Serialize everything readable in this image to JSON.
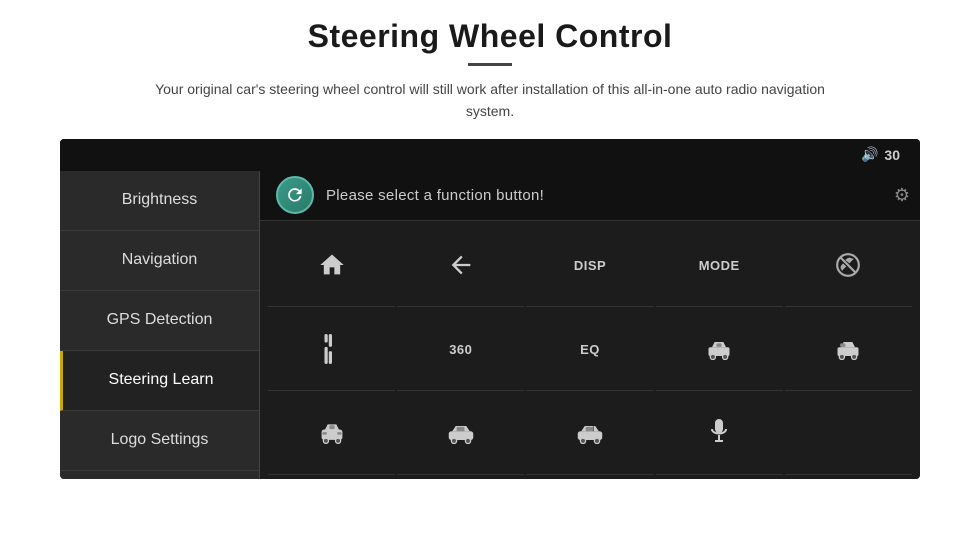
{
  "page": {
    "title": "Steering Wheel Control",
    "subtitle": "Your original car's steering wheel control will still work after installation of this all-in-one auto radio navigation system.",
    "divider": true
  },
  "topbar": {
    "volume_icon": "🔊",
    "volume_value": "30"
  },
  "sidebar": {
    "items": [
      {
        "id": "brightness",
        "label": "Brightness",
        "active": false
      },
      {
        "id": "navigation",
        "label": "Navigation",
        "active": false
      },
      {
        "id": "gps-detection",
        "label": "GPS Detection",
        "active": false
      },
      {
        "id": "steering-learn",
        "label": "Steering Learn",
        "active": true
      },
      {
        "id": "logo-settings",
        "label": "Logo Settings",
        "active": false
      }
    ]
  },
  "function_bar": {
    "prompt": "Please select a function button!"
  },
  "grid": {
    "rows": [
      [
        {
          "type": "home",
          "label": ""
        },
        {
          "type": "back",
          "label": ""
        },
        {
          "type": "text",
          "label": "DISP"
        },
        {
          "type": "text",
          "label": "MODE"
        },
        {
          "type": "no-call",
          "label": ""
        }
      ],
      [
        {
          "type": "tuner",
          "label": ""
        },
        {
          "type": "text",
          "label": "360"
        },
        {
          "type": "text",
          "label": "EQ"
        },
        {
          "type": "car-icon",
          "label": ""
        },
        {
          "type": "car-icon2",
          "label": ""
        }
      ],
      [
        {
          "type": "car-front",
          "label": ""
        },
        {
          "type": "car-side",
          "label": ""
        },
        {
          "type": "car-side2",
          "label": ""
        },
        {
          "type": "mic",
          "label": ""
        },
        {
          "type": "empty",
          "label": ""
        }
      ]
    ]
  }
}
